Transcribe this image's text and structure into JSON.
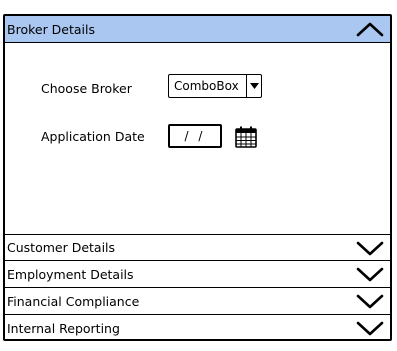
{
  "accordion": {
    "sections": [
      {
        "title": "Broker Details",
        "expanded": true,
        "icon": "chevron-up-icon"
      },
      {
        "title": "Customer Details",
        "expanded": false,
        "icon": "chevron-down-icon"
      },
      {
        "title": "Employment Details",
        "expanded": false,
        "icon": "chevron-down-icon"
      },
      {
        "title": "Financial Compliance",
        "expanded": false,
        "icon": "chevron-down-icon"
      },
      {
        "title": "Internal Reporting",
        "expanded": false,
        "icon": "chevron-down-icon"
      }
    ],
    "active_color": "#a9c7f1"
  },
  "form": {
    "broker_label": "Choose Broker",
    "broker_value": "ComboBox",
    "broker_dropdown_icon": "triangle-down-icon",
    "date_label": "Application Date",
    "date_value": "/ /",
    "calendar_icon": "calendar-icon"
  }
}
